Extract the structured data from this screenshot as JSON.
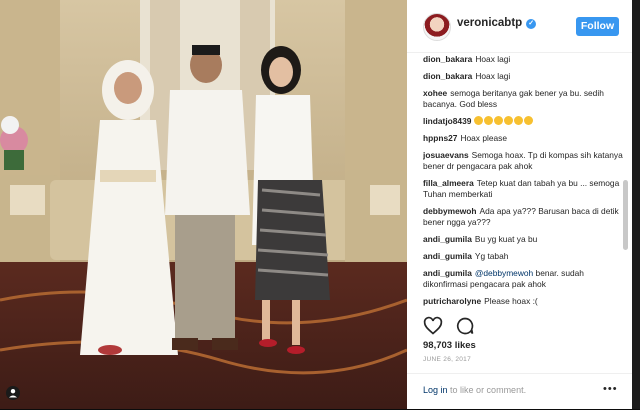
{
  "post": {
    "username": "veronicabtp",
    "follow_label": "Follow",
    "likes": "98,703 likes",
    "date": "JUNE 26, 2017"
  },
  "comments": [
    {
      "user": "dion_bakara",
      "text": "Hoax lagi"
    },
    {
      "user": "dion_bakara",
      "text": "Hoax lagi"
    },
    {
      "user": "xohee",
      "text": "semoga beritanya gak bener ya bu. sedih bacanya. God bless"
    },
    {
      "user": "lindatjo8439",
      "text": ""
    },
    {
      "user": "hppns27",
      "text": "Hoax please"
    },
    {
      "user": "josuaevans",
      "text": "Semoga hoax. Tp di kompas sih katanya bener dr pengacara pak ahok"
    },
    {
      "user": "filla_almeera",
      "text": "Tetep kuat dan tabah ya bu ... semoga Tuhan memberkati"
    },
    {
      "user": "debbymewoh",
      "text": "Ada apa ya??? Barusan baca di detik bener ngga ya???"
    },
    {
      "user": "andi_gumila",
      "text": "Bu yg kuat ya bu"
    },
    {
      "user": "andi_gumila",
      "text": "Yg tabah"
    },
    {
      "user": "andi_gumila",
      "mention": "@debbymewoh",
      "text": "benar. sudah dikonfirmasi pengacara pak ahok"
    },
    {
      "user": "putricharolyne",
      "text": "Please hoax :("
    }
  ],
  "footer": {
    "login_text": "Log in",
    "login_suffix": "to like or comment.",
    "more": "•••"
  }
}
